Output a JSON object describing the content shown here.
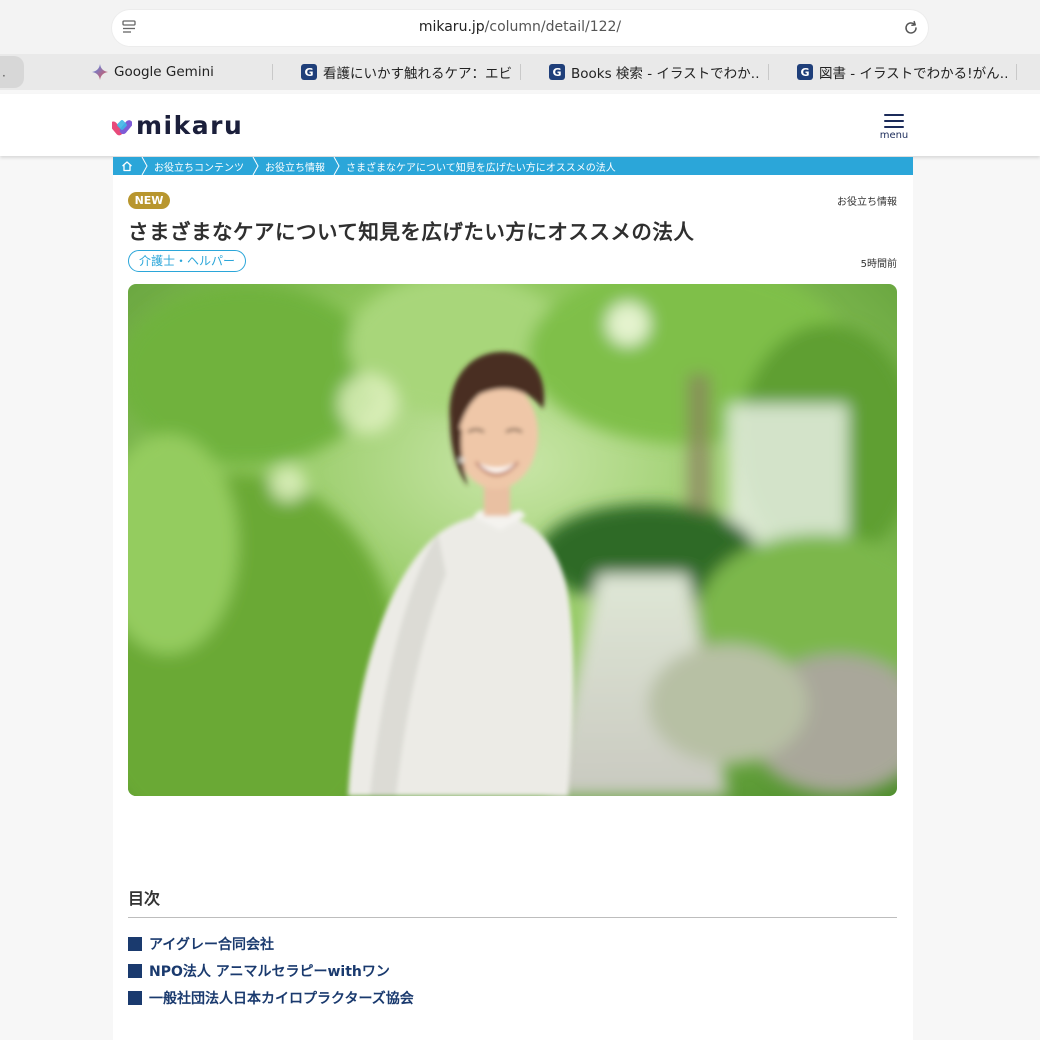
{
  "browser": {
    "url_host": "mikaru.jp",
    "url_path": "/column/detail/122/",
    "first_tab_label": "·",
    "tabs": [
      {
        "label": "Google Gemini",
        "icon": "gemini-sparkle-icon"
      },
      {
        "label": "看護にいかす触れるケア：エビ…",
        "icon": "g-favicon"
      },
      {
        "label": "Books 検索 - イラストでわか…",
        "icon": "g-favicon"
      },
      {
        "label": "図書 - イラストでわかる!がん…",
        "icon": "g-favicon"
      }
    ],
    "favicon_letter": "G"
  },
  "site": {
    "logo_text": "mikaru",
    "menu_label": "menu",
    "brand_colors": {
      "primary": "#2ba6d9",
      "navy": "#1a3a6e",
      "new_badge": "#b8962e"
    }
  },
  "breadcrumb": {
    "items": [
      "お役立ちコンテンツ",
      "お役立ち情報",
      "さまざまなケアについて知見を広げたい方にオススメの法人"
    ]
  },
  "article": {
    "badge": "NEW",
    "category": "お役立ち情報",
    "title": "さまざまなケアについて知見を広げたい方にオススメの法人",
    "tag": "介護士・ヘルパー",
    "time_ago": "5時間前",
    "hero_image": "smiling woman in light shirt outdoors among green trees"
  },
  "toc": {
    "heading": "目次",
    "items": [
      "アイグレー合同会社",
      "NPO法人 アニマルセラピーwithワン",
      "一般社団法人日本カイロプラクターズ協会"
    ]
  }
}
